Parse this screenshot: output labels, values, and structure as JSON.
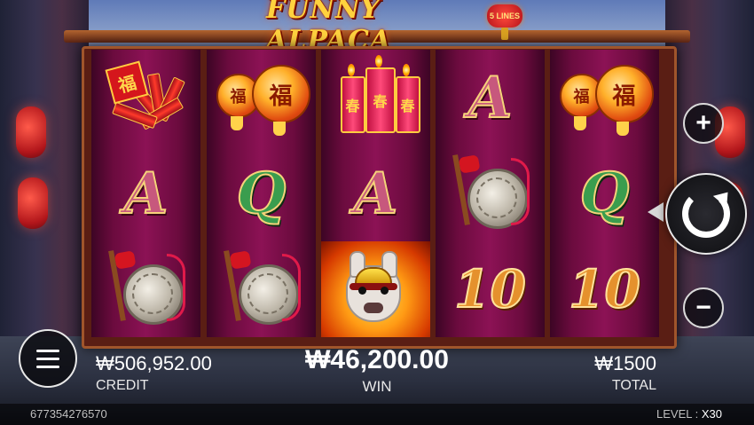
{
  "game": {
    "title": "FUNNY ALPACA",
    "lines_badge": "5 LINES"
  },
  "reels": [
    [
      "firecrackers-bundle-symbol",
      "A",
      "gong-symbol"
    ],
    [
      "lanterns-symbol",
      "Q",
      "gong-symbol"
    ],
    [
      "firecracker-sticks-symbol",
      "A",
      "alpaca-wild-symbol"
    ],
    [
      "A",
      "gong-symbol",
      "10"
    ],
    [
      "lanterns-symbol",
      "Q",
      "10"
    ]
  ],
  "symbols": {
    "A": "A",
    "Q": "Q",
    "ten": "10",
    "lantern_char": "福",
    "cracker_char": "春",
    "seal_char": "福"
  },
  "controls": {
    "plus_label": "+",
    "minus_label": "−",
    "spin_icon": "refresh-icon",
    "menu_icon": "hamburger-icon"
  },
  "status": {
    "credit_value": "₩506,952.00",
    "credit_label": "CREDIT",
    "win_value": "₩46,200.00",
    "win_label": "WIN",
    "total_value": "₩1500",
    "total_label": "TOTAL",
    "game_id": "677354276570",
    "level_label": "LEVEL :",
    "level_value": "X30"
  },
  "colors": {
    "reel_bg": "#8c1255",
    "letter_a": "#c7587d",
    "letter_q": "#3a9d4e",
    "letter_ten": "#e5912d",
    "title_gold": "#ffd23e"
  }
}
